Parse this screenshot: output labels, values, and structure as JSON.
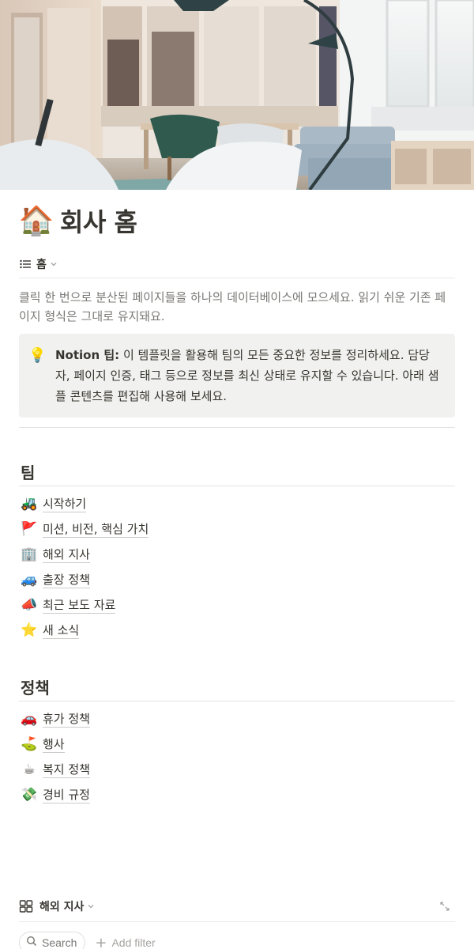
{
  "cover": {
    "alt_icon": "office-interior-photo"
  },
  "page": {
    "emoji": "🏠",
    "title": "회사 홈"
  },
  "view": {
    "icon": "list-icon",
    "label": "홈"
  },
  "description": "클릭 한 번으로 분산된 페이지들을 하나의 데이터베이스에 모으세요. 읽기 쉬운 기존 페이지 형식은 그대로 유지돼요.",
  "callout": {
    "icon": "💡",
    "bold": "Notion 팁:",
    "text": " 이 템플릿을 활용해 팀의 모든 중요한 정보를 정리하세요. 담당자, 페이지 인증, 태그 등으로 정보를 최신 상태로 유지할 수 있습니다. 아래 샘플 콘텐츠를 편집해 사용해 보세요."
  },
  "sections": {
    "team": {
      "heading": "팀",
      "items": [
        {
          "emoji": "🚜",
          "label": "시작하기"
        },
        {
          "emoji": "🚩",
          "label": "미션, 비전, 핵심 가치"
        },
        {
          "emoji": "🏢",
          "label": "해외 지사"
        },
        {
          "emoji": "🚙",
          "label": "출장 정책"
        },
        {
          "emoji": "📣",
          "label": "최근 보도 자료"
        },
        {
          "emoji": "⭐",
          "label": "새 소식"
        }
      ]
    },
    "policy": {
      "heading": "정책",
      "items": [
        {
          "emoji": "🚗",
          "label": "휴가 정책"
        },
        {
          "emoji": "⛳",
          "label": "행사"
        },
        {
          "emoji": "☕",
          "label": "복지 정책"
        },
        {
          "emoji": "💸",
          "label": "경비 규정"
        }
      ]
    }
  },
  "database": {
    "icon": "gallery-grid-icon",
    "label": "해외 지사",
    "search_label": "Search",
    "add_filter_label": "Add filter"
  }
}
